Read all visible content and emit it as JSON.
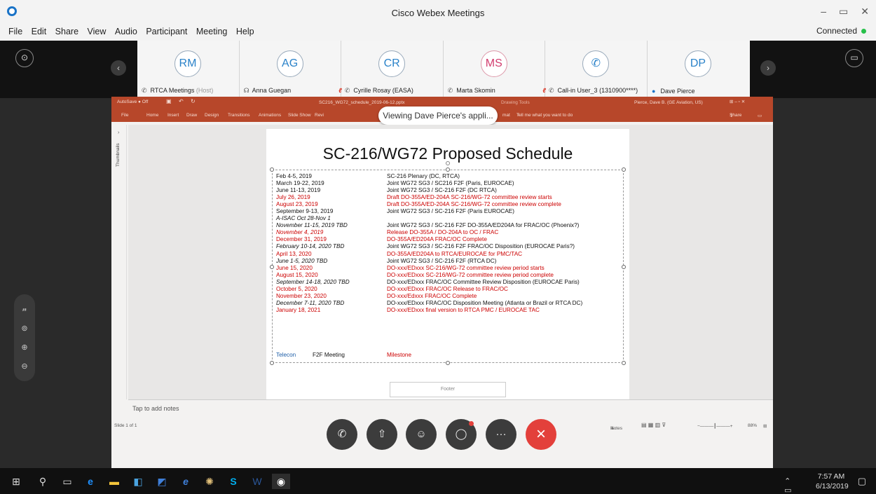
{
  "window": {
    "title": "Cisco Webex Meetings",
    "controls": [
      "–",
      "▭",
      "✕"
    ]
  },
  "menu": {
    "items": [
      "File",
      "Edit",
      "Share",
      "View",
      "Audio",
      "Participant",
      "Meeting",
      "Help"
    ],
    "status": "Connected"
  },
  "participants": [
    {
      "initials": "RM",
      "name": "RTCA Meetings",
      "note": "(Host)",
      "icon": "phone-icon",
      "muted": false
    },
    {
      "initials": "AG",
      "name": "Anna Guegan",
      "note": "",
      "icon": "headset-icon",
      "muted": false
    },
    {
      "initials": "CR",
      "name": "Cyrille Rosay (EASA)",
      "note": "",
      "icon": "phone-icon",
      "muted": true
    },
    {
      "initials": "MS",
      "name": "Marta Skomin",
      "note": "",
      "icon": "phone-icon",
      "muted": false
    },
    {
      "initials": "",
      "name": "Call-in User_3 (1310900****)",
      "note": "",
      "icon": "phone-icon",
      "muted": true
    },
    {
      "initials": "DP",
      "name": "Dave Pierce",
      "note": "",
      "icon": "webex-icon",
      "muted": false
    }
  ],
  "share_banner": "Viewing Dave Pierce's appli...",
  "ppt": {
    "autosave": "AutoSave ● Off",
    "filename": "SC216_WG72_schedule_2019-06-12.pptx",
    "drawing_tools": "Drawing Tools",
    "user": "Pierce, Dave B. (GE Aviation, US)",
    "tabs": [
      "File",
      "Home",
      "Insert",
      "Draw",
      "Design",
      "Transitions",
      "Animations",
      "Slide Show",
      "Revi",
      "mat"
    ],
    "tell_me": "Tell me what you want to do",
    "share_label": "Share",
    "thumbnails_label": "Thumbnails",
    "notes_placeholder": "Tap to add notes",
    "slide_counter": "Slide 1 of 1",
    "notes_btn": "Notes",
    "zoom": "88%"
  },
  "slide": {
    "title": "SC-216/WG72 Proposed Schedule",
    "rows": [
      {
        "date": "Feb 4-5, 2019",
        "event": "SC-216 Plenary (DC, RTCA)",
        "color": "black",
        "italic": false
      },
      {
        "date": "March 19-22, 2019",
        "event": "Joint WG72 SG3 / SC216 F2F (Paris, EUROCAE)",
        "color": "black",
        "italic": false
      },
      {
        "date": "June 11-13, 2019",
        "event": "Joint WG72 SG3 / SC-216 F2F (DC RTCA)",
        "color": "black",
        "italic": false
      },
      {
        "date": "July 26, 2019",
        "event": "Draft DO-355A/ED-204A SC-216/WG-72 committee review starts",
        "color": "red",
        "italic": false
      },
      {
        "date": "August 23, 2019",
        "event": "Draft DO-355A/ED-204A SC-216/WG-72 committee review complete",
        "color": "red",
        "italic": false
      },
      {
        "date": "September 9-13, 2019",
        "event": "Joint WG72 SG3 / SC-216 F2F (Paris EUROCAE)",
        "color": "black",
        "italic": false
      },
      {
        "date": "A-ISAC Oct 28-Nov 1",
        "event": "",
        "color": "black",
        "italic": true
      },
      {
        "date": "November 11-15, 2019 TBD",
        "event": "Joint WG72 SG3 / SC-216 F2F DO-355A/ED204A for FRAC/OC (Phoenix?)",
        "color": "black",
        "italic": true
      },
      {
        "date": "November 4, 2019",
        "event": "Release DO-355A / DO-204A to OC / FRAC",
        "color": "red",
        "italic": true
      },
      {
        "date": "December 31, 2019",
        "event": "DO-355A/ED204A FRAC/OC Complete",
        "color": "red",
        "italic": false
      },
      {
        "date": "February 10-14, 2020 TBD",
        "event": "Joint WG72 SG3 / SC-216 F2F FRAC/OC Disposition (EUROCAE Paris?)",
        "color": "black",
        "italic": true
      },
      {
        "date": "April 13, 2020",
        "event": "DO-355A/ED204A to RTCA/EUROCAE for PMC/TAC",
        "color": "red",
        "italic": false
      },
      {
        "date": "June 1-5, 2020 TBD",
        "event": "Joint WG72 SG3 / SC-216 F2F (RTCA DC)",
        "color": "black",
        "italic": true
      },
      {
        "date": "June 15, 2020",
        "event": "DO-xxx/EDxxx SC-216/WG-72 committee review period starts",
        "color": "red",
        "italic": false
      },
      {
        "date": "August 15, 2020",
        "event": "DO-xxx/EDxxx SC-216/WG-72 committee review period complete",
        "color": "red",
        "italic": false
      },
      {
        "date": "September 14-18, 2020 TBD",
        "event": "DO-xxx/EDxxx FRAC/OC Committee Review Disposition (EUROCAE Paris)",
        "color": "black",
        "italic": true
      },
      {
        "date": "October 5, 2020",
        "event": "DO-xxx/EDxxx FRAC/OC Release to FRAC/OC",
        "color": "red",
        "italic": false
      },
      {
        "date": "November 23, 2020",
        "event": "DO-xxx/Edxxx FRAC/OC Complete",
        "color": "red",
        "italic": false
      },
      {
        "date": "December 7-11, 2020 TBD",
        "event": "DO-xxx/EDxxx FRAC/OC Disposition Meeting (Atlanta or Brazil or RTCA DC)",
        "color": "black",
        "italic": true
      },
      {
        "date": "January 18, 2021",
        "event": "DO-xxx/EDxxx final version to RTCA PMC / EUROCAE TAC",
        "color": "red",
        "italic": false
      }
    ],
    "legend": {
      "telecon": "Telecon",
      "f2f": "F2F Meeting",
      "milestone": "Milestone"
    },
    "footer": "Footer"
  },
  "controls": [
    {
      "name": "audio-button",
      "icon": "phone-icon",
      "glyph": "✆"
    },
    {
      "name": "share-button",
      "icon": "share-icon",
      "glyph": "⇧"
    },
    {
      "name": "participants-button",
      "icon": "participants-icon",
      "glyph": "☺"
    },
    {
      "name": "chat-button",
      "icon": "chat-icon",
      "glyph": "◯"
    },
    {
      "name": "more-button",
      "icon": "more-icon",
      "glyph": "···"
    },
    {
      "name": "end-meeting-button",
      "icon": "close-icon",
      "glyph": "✕"
    }
  ],
  "taskbar": {
    "time": "7:57 AM",
    "date": "6/13/2019"
  },
  "colors": {
    "ppt_ribbon": "#b7472a",
    "end_button": "#e3403b",
    "red_text": "#c00000",
    "telecon_blue": "#1f5fa8",
    "connected": "#27c04a"
  }
}
